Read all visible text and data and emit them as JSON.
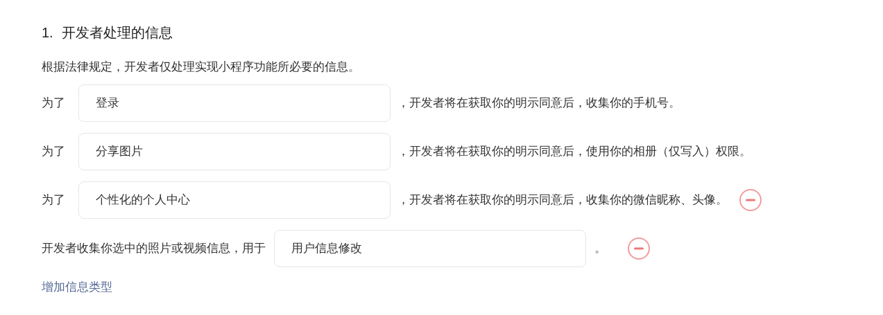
{
  "section": {
    "number": "1.",
    "title": "开发者处理的信息"
  },
  "description": "根据法律规定，开发者仅处理实现小程序功能所必要的信息。",
  "rows": [
    {
      "kind": "purpose",
      "prefix": "为了",
      "value": "登录",
      "suffix": "，开发者将在获取你的明示同意后，收集你的手机号。",
      "removable": false
    },
    {
      "kind": "purpose",
      "prefix": "为了",
      "value": "分享图片",
      "suffix": "，开发者将在获取你的明示同意后，使用你的相册（仅写入）权限。",
      "removable": false
    },
    {
      "kind": "purpose",
      "prefix": "为了",
      "value": "个性化的个人中心",
      "suffix": "，开发者将在获取你的明示同意后，收集你的微信昵称、头像。",
      "removable": true
    },
    {
      "kind": "media",
      "prefix": "开发者收集你选中的照片或视频信息，用于",
      "value": "用户信息修改",
      "suffix": "。",
      "removable": true
    }
  ],
  "add_link": "增加信息类型"
}
